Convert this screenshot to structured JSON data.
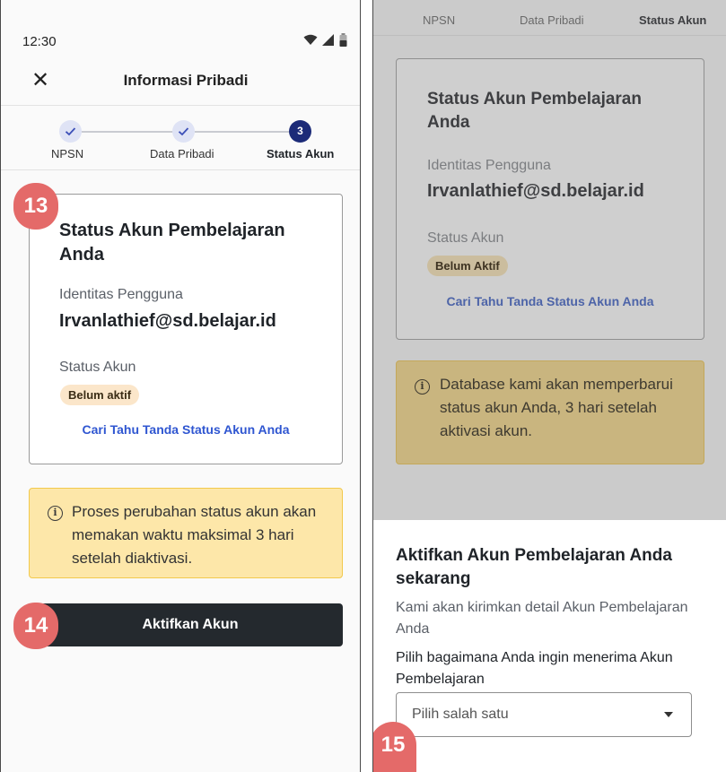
{
  "left_screen": {
    "status_bar": {
      "time": "12:30"
    },
    "app_bar": {
      "title": "Informasi Pribadi"
    },
    "stepper": {
      "steps": [
        {
          "label": "NPSN",
          "state": "done"
        },
        {
          "label": "Data Pribadi",
          "state": "done"
        },
        {
          "label": "Status Akun",
          "state": "active",
          "number": "3"
        }
      ]
    },
    "card": {
      "title": "Status Akun Pembelajaran Anda",
      "identity_label": "Identitas Pengguna",
      "identity_value": "Irvanlathief@sd.belajar.id",
      "status_label": "Status Akun",
      "status_badge": "Belum aktif",
      "link": "Cari Tahu Tanda Status Akun Anda"
    },
    "info": {
      "text": "Proses perubahan status akun akan memakan waktu maksimal 3 hari setelah diaktivasi."
    },
    "primary_button": "Aktifkan Akun"
  },
  "right_screen": {
    "stepper_labels": [
      "NPSN",
      "Data Pribadi",
      "Status Akun"
    ],
    "card": {
      "title": "Status Akun Pembelajaran Anda",
      "identity_label": "Identitas Pengguna",
      "identity_value": "Irvanlathief@sd.belajar.id",
      "status_label": "Status Akun",
      "status_badge": "Belum Aktif",
      "link": "Cari Tahu Tanda Status Akun Anda"
    },
    "info": {
      "text": "Database kami akan memperbarui status akun Anda, 3 hari setelah aktivasi akun."
    },
    "bottom_sheet": {
      "title": "Aktifkan Akun Pembelajaran Anda sekarang",
      "description": "Kami akan kirimkan detail Akun Pembelajaran Anda",
      "select_label": "Pilih bagaimana Anda ingin menerima Akun Pembelajaran",
      "select_value": "Pilih salah satu"
    }
  },
  "markers": [
    "13",
    "14",
    "15"
  ],
  "colors": {
    "primary_button": "#24292e",
    "step_active": "#1c2b78",
    "link": "#2f56d1",
    "warning_bg": "#fde7a9",
    "badge_bg": "#fbe6ca",
    "marker": "#e46a69"
  },
  "icons": [
    "close-icon",
    "check-icon",
    "wifi-icon",
    "signal-icon",
    "battery-icon",
    "info-icon",
    "chevron-down-icon"
  ]
}
